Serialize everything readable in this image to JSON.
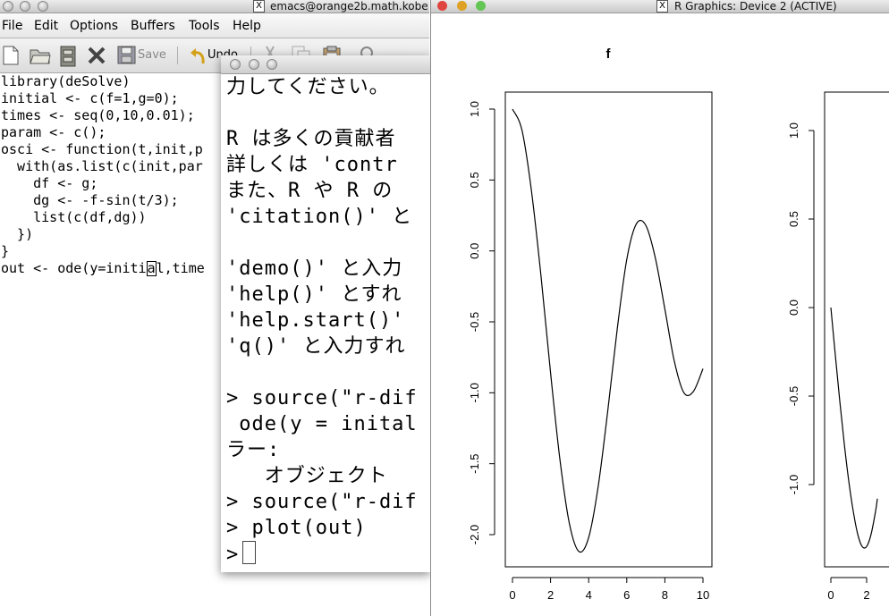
{
  "emacs": {
    "title": "emacs@orange2b.math.kobe",
    "menu": [
      "File",
      "Edit",
      "Options",
      "Buffers",
      "Tools",
      "Help"
    ],
    "toolbar": {
      "save_label": "Save",
      "undo_label": "Undo"
    },
    "code_lines": [
      "library(deSolve)",
      "initial <- c(f=1,g=0);",
      "times <- seq(0,10,0.01);",
      "param <- c();",
      "osci <- function(t,init,p",
      "  with(as.list(c(init,par",
      "    df <- g;",
      "    dg <- -f-sin(t/3);",
      "    list(c(df,dg))",
      "  })",
      "}"
    ],
    "last_line_before": "out <- ode(y=initi",
    "last_line_cursor": "a",
    "last_line_after": "l,time"
  },
  "rconsole": {
    "lines": [
      "力してください。",
      "",
      "R は多くの貢献者",
      "詳しくは 'contr",
      "また、R や R の",
      "'citation()' と",
      "",
      "'demo()' と入力",
      "'help()' とすれ",
      "'help.start()' ",
      "'q()' と入力すれ",
      "",
      "> source(\"r-dif",
      " ode(y = inital",
      "ラー:",
      "   オブジェクト",
      "> source(\"r-dif",
      "> plot(out)"
    ],
    "prompt": ">"
  },
  "rgraphics": {
    "title": "R Graphics: Device 2 (ACTIVE)",
    "button_colors": {
      "close": "#e0443e",
      "minimize": "#dea123",
      "zoom": "#62c554"
    }
  },
  "chart_data": [
    {
      "type": "line",
      "title": "f",
      "xlabel": "",
      "ylabel": "",
      "xlim": [
        0,
        10
      ],
      "ylim": [
        -2.1,
        1.0
      ],
      "x_ticks": [
        "0",
        "2",
        "4",
        "6",
        "8",
        "10"
      ],
      "y_ticks": [
        "1.0",
        "0.5",
        "0.0",
        "-0.5",
        "-1.0",
        "-1.5",
        "-2.0"
      ],
      "x": [
        0,
        0.5,
        1,
        1.5,
        2,
        2.5,
        3,
        3.5,
        4,
        4.5,
        5,
        5.5,
        6,
        6.5,
        7,
        7.5,
        8,
        8.5,
        9,
        9.5,
        10
      ],
      "y": [
        1.0,
        0.85,
        0.42,
        -0.18,
        -0.86,
        -1.48,
        -1.93,
        -2.12,
        -2.02,
        -1.66,
        -1.13,
        -0.55,
        -0.06,
        0.19,
        0.18,
        -0.05,
        -0.41,
        -0.78,
        -1.0,
        -0.99,
        -0.83
      ]
    },
    {
      "type": "line",
      "title": "",
      "xlabel": "",
      "ylabel": "",
      "xlim": [
        0,
        2.6
      ],
      "ylim": [
        -1.4,
        1.2
      ],
      "x_ticks": [
        "0",
        "2"
      ],
      "y_ticks": [
        "1.0",
        "0.5",
        "0.0",
        "-0.5",
        "-1.0"
      ],
      "x": [
        0,
        0.25,
        0.5,
        0.75,
        1,
        1.25,
        1.5,
        1.75,
        2,
        2.25,
        2.5,
        2.6
      ],
      "y": [
        0.0,
        -0.27,
        -0.53,
        -0.77,
        -0.98,
        -1.15,
        -1.28,
        -1.35,
        -1.35,
        -1.28,
        -1.15,
        -1.08
      ]
    }
  ]
}
